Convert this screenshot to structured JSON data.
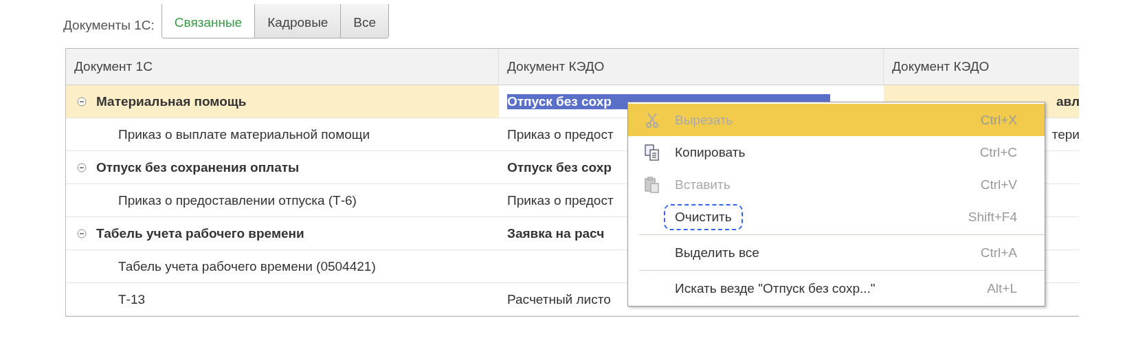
{
  "filter": {
    "label": "Документы 1С:",
    "tabs": [
      {
        "label": "Связанные",
        "selected": true
      },
      {
        "label": "Кадровые",
        "selected": false
      },
      {
        "label": "Все",
        "selected": false
      }
    ]
  },
  "table": {
    "columns": [
      "Документ 1С",
      "Документ КЭДО",
      "Документ КЭДО"
    ],
    "rows": [
      {
        "cells": [
          "Материальная помощь",
          "Отпуск без сохр",
          "авл"
        ],
        "selected": true,
        "text_selected": true,
        "expanded": true,
        "children": [
          {
            "cells": [
              "Приказ о выплате материальной помощи",
              "Приказ о предост",
              "тери"
            ],
            "selected": false,
            "text_selected": false
          }
        ]
      },
      {
        "cells": [
          "Отпуск без сохранения оплаты",
          "Отпуск без сохр",
          ""
        ],
        "selected": false,
        "text_selected": false,
        "expanded": true,
        "children": [
          {
            "cells": [
              "Приказ о предоставлении отпуска (Т-6)",
              "Приказ о предост",
              ""
            ],
            "selected": false,
            "text_selected": false
          }
        ]
      },
      {
        "cells": [
          "Табель учета рабочего времени",
          "Заявка на расч",
          ""
        ],
        "selected": false,
        "text_selected": false,
        "expanded": true,
        "children": [
          {
            "cells": [
              "Табель учета рабочего времени (0504421)",
              "",
              ""
            ],
            "selected": false,
            "text_selected": false
          },
          {
            "cells": [
              "Т-13",
              "Расчетный листо",
              ""
            ],
            "selected": false,
            "text_selected": false
          }
        ]
      }
    ]
  },
  "context_menu": {
    "items": [
      {
        "label": "Вырезать",
        "shortcut": "Ctrl+X",
        "kind": "cut",
        "disabled": true,
        "selected": true,
        "separator_before": false,
        "outlined": false
      },
      {
        "label": "Копировать",
        "shortcut": "Ctrl+C",
        "kind": "copy",
        "disabled": false,
        "selected": false,
        "separator_before": false,
        "outlined": false
      },
      {
        "label": "Вставить",
        "shortcut": "Ctrl+V",
        "kind": "paste",
        "disabled": true,
        "selected": false,
        "separator_before": false,
        "outlined": false
      },
      {
        "label": "Очистить",
        "shortcut": "Shift+F4",
        "kind": "plain",
        "disabled": false,
        "selected": false,
        "separator_before": false,
        "outlined": true
      },
      {
        "label": "Выделить все",
        "shortcut": "Ctrl+A",
        "kind": "plain",
        "disabled": false,
        "selected": false,
        "separator_before": true,
        "outlined": false
      },
      {
        "label": "Искать везде \"Отпуск без сохр...\"",
        "shortcut": "Alt+L",
        "kind": "plain",
        "disabled": false,
        "selected": false,
        "separator_before": true,
        "outlined": false
      }
    ]
  }
}
